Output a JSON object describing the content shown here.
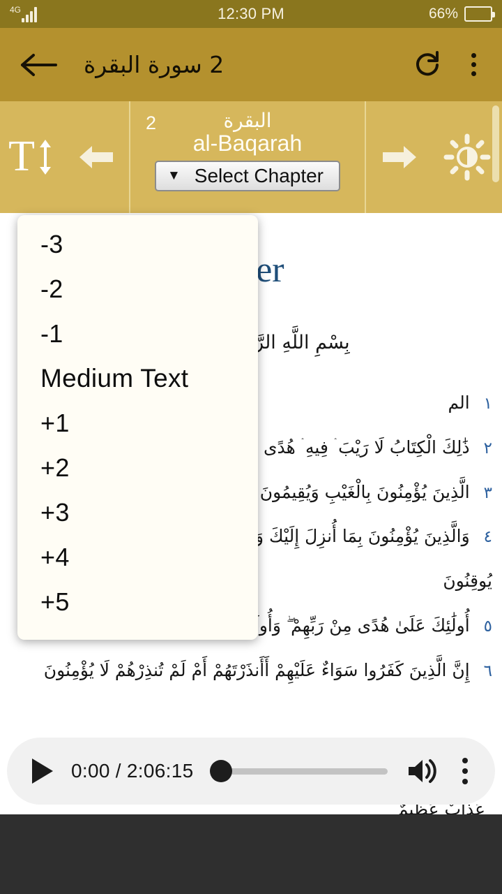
{
  "status_bar": {
    "network_label": "4G",
    "time": "12:30 PM",
    "battery_percent": "66%"
  },
  "app_bar": {
    "back_icon": "back-arrow-icon",
    "title": "2 سورة البقرة",
    "refresh_icon": "refresh-icon",
    "overflow_icon": "overflow-menu-icon"
  },
  "reader_toolbar": {
    "text_size_icon": "text-size-icon",
    "prev_icon": "arrow-left-icon",
    "next_icon": "arrow-right-icon",
    "brightness_icon": "brightness-icon",
    "chapter_number": "2",
    "chapter_arabic": "البقرة",
    "chapter_english": "al-Baqarah",
    "select_chapter_label": "Select Chapter",
    "select_caret": "▼"
  },
  "text_size_menu": {
    "items": [
      {
        "label": "-3"
      },
      {
        "label": "-2"
      },
      {
        "label": "-1"
      },
      {
        "label": "Medium Text"
      },
      {
        "label": "+1"
      },
      {
        "label": "+2"
      },
      {
        "label": "+3"
      },
      {
        "label": "+4"
      },
      {
        "label": "+5"
      }
    ]
  },
  "content": {
    "heading": "eifer",
    "basmala": "بِسْمِ اللَّهِ الرَّحْمَٰنِ الرَّحِيمِ",
    "verses": [
      {
        "number": "١",
        "text": "الم"
      },
      {
        "number": "٢",
        "text": "ذَٰلِكَ الْكِتَابُ لَا رَيْبَ ۛ فِيهِ ۛ هُدًى لِ"
      },
      {
        "number": "٣",
        "text": "الَّذِينَ يُؤْمِنُونَ بِالْغَيْبِ وَيُقِيمُونَ"
      },
      {
        "number": "٤",
        "text": "وَالَّذِينَ يُؤْمِنُونَ بِمَا أُنزِلَ إِلَيْكَ وَ"
      },
      {
        "number": "",
        "text": "يُوقِنُونَ"
      },
      {
        "number": "٥",
        "text": "أُولَٰئِكَ عَلَىٰ هُدًى مِنْ رَبِّهِمْ ۖ وَأُولَٰئِكَ هُمُ الْمُفْلِحُونَ"
      },
      {
        "number": "٦",
        "text": "إِنَّ الَّذِينَ كَفَرُوا سَوَاءٌ عَلَيْهِمْ أَأَنذَرْتَهُمْ أَمْ لَمْ تُنذِرْهُمْ لَا يُؤْمِنُونَ"
      }
    ],
    "clipped_line": "عَذَابٌ عَظِيمٌ"
  },
  "audio_player": {
    "play_icon": "play-icon",
    "time_display": "0:00 / 2:06:15",
    "volume_icon": "volume-icon",
    "overflow_icon": "player-overflow-icon",
    "progress_percent": 0
  },
  "colors": {
    "status_bar": "#8a761e",
    "app_bar": "#b4912e",
    "reader_toolbar": "#d6b75c",
    "heading_blue": "#1f4e79",
    "verse_number_blue": "#2b5f9e",
    "menu_background": "#fffdf5",
    "player_background": "#f1f1f1",
    "nav_bar": "#2f2f2f"
  }
}
